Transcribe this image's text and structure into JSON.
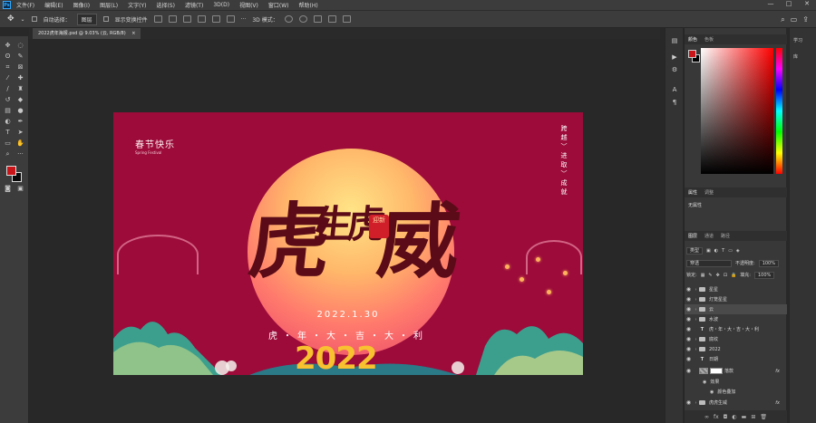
{
  "menubar": {
    "items": [
      "文件(F)",
      "编辑(E)",
      "图像(I)",
      "图层(L)",
      "文字(Y)",
      "选择(S)",
      "滤镜(T)",
      "3D(D)",
      "视图(V)",
      "窗口(W)",
      "帮助(H)"
    ]
  },
  "options": {
    "auto_select": "自动选择：",
    "auto_select_target": "图层",
    "show_transform": "显示变换控件",
    "mode_3d": "3D 模式："
  },
  "document": {
    "tab_title": "2022虎年海报.psd @ 9.03% (云, RGB/8)",
    "close": "×"
  },
  "poster": {
    "title": "春节快乐",
    "subtitle": "Spring Festival",
    "vertical_text": "跨越〉进取〉成就",
    "calligraphy_main": "虎威",
    "calligraphy_small": "生虎",
    "stamp": "迎新",
    "date": "2022.1.30",
    "slogan": "虎・年・大・吉・大・利",
    "year": "2022"
  },
  "panels": {
    "color_tab": "颜色",
    "swatches_tab": "色板",
    "properties_tab": "属性",
    "adjustments_tab": "调整",
    "no_properties": "无属性",
    "layers_tab": "图层",
    "channels_tab": "通道",
    "paths_tab": "路径",
    "kind": "类型",
    "blend_mode": "穿透",
    "opacity_label": "不透明度:",
    "opacity_value": "100%",
    "lock_label": "锁定:",
    "fill_label": "填充:",
    "fill_value": "100%"
  },
  "layers": [
    {
      "name": "星星",
      "type": "folder",
      "selected": false
    },
    {
      "name": "灯笼星星",
      "type": "folder",
      "selected": false
    },
    {
      "name": "云",
      "type": "folder",
      "selected": true
    },
    {
      "name": "水波",
      "type": "folder",
      "selected": false
    },
    {
      "name": "虎・年・大・吉・大・利",
      "type": "text",
      "selected": false
    },
    {
      "name": "底纹",
      "type": "folder",
      "selected": false
    },
    {
      "name": "2022",
      "type": "folder",
      "selected": false
    },
    {
      "name": "日期",
      "type": "text",
      "selected": false
    },
    {
      "name": "落款",
      "type": "image",
      "selected": false,
      "fx": "fx"
    },
    {
      "name": "效果",
      "type": "effect",
      "selected": false
    },
    {
      "name": "颜色叠加",
      "type": "effect",
      "selected": false
    },
    {
      "name": "虎虎生威",
      "type": "folder",
      "selected": false,
      "fx": "fx"
    }
  ],
  "far_panel": {
    "learn": "学习",
    "library": "库"
  },
  "colors": {
    "foreground": "#c8151a",
    "background": "#000000",
    "poster_bg": "#9c0b3a"
  }
}
